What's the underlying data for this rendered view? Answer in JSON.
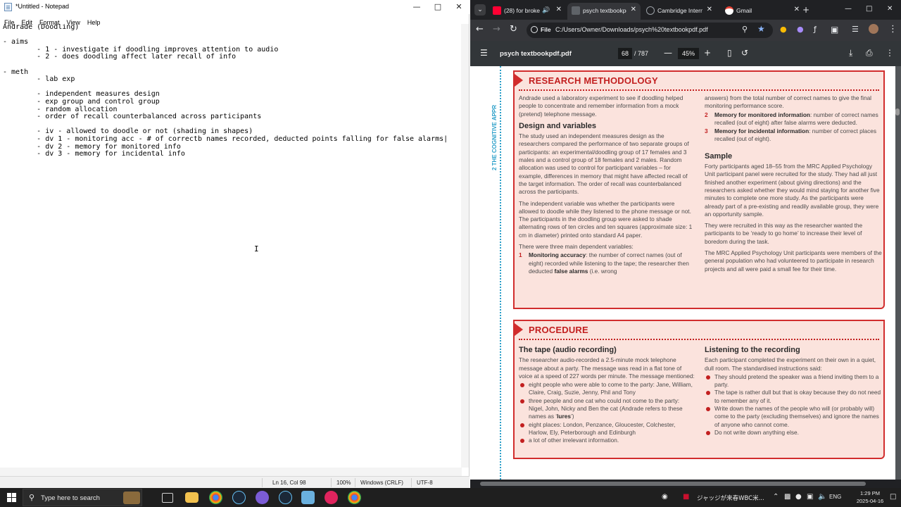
{
  "notepad": {
    "title": "*Untitled - Notepad",
    "menu": [
      "File",
      "Edit",
      "Format",
      "View",
      "Help"
    ],
    "lines": [
      "Andrade (Doodling)",
      "",
      "- aims",
      "        - 1 - investigate if doodling improves attention to audio",
      "        - 2 - does doodling affect later recall of info",
      "",
      "- meth",
      "        - lab exp",
      "",
      "        - independent measures design",
      "        - exp group and control group",
      "        - random allocation",
      "        - order of recall counterbalanced across participants",
      "",
      "        - iv - allowed to doodle or not (shading in shapes)",
      "        - dv 1 - monitoring acc - # of correctb names recorded, deducted points falling for false alarms|",
      "        - dv 2 - memory for monitored info",
      "        - dv 3 - memory for incidental info"
    ],
    "status": {
      "position": "Ln 16, Col 98",
      "zoom": "100%",
      "line_endings": "Windows (CRLF)",
      "encoding": "UTF-8"
    }
  },
  "chrome": {
    "tabs": [
      {
        "label": "(28) for broke",
        "favicon_color": "#ff0033",
        "active": false
      },
      {
        "label": "psych textbookpd",
        "favicon_color": "#5f6368",
        "active": true
      },
      {
        "label": "Cambridge Intern",
        "favicon_color": "#9aa0a6",
        "active": false
      },
      {
        "label": "Gmail",
        "favicon_color": "#ffffff",
        "active": false
      }
    ],
    "omnibox": {
      "scheme_chip": "File",
      "url": "C:/Users/Owner/Downloads/psych%20textbookpdf.pdf"
    },
    "pdf": {
      "title": "psych textbookpdf.pdf",
      "page": "68",
      "total": "/ 787",
      "zoom": "45%"
    }
  },
  "document": {
    "side_label": "2 THE COGNITIVE APPR",
    "research": {
      "heading": "RESEARCH METHODOLOGY",
      "intro": "Andrade used a laboratory experiment to see if doodling helped people to concentrate and remember information from a mock (pretend) telephone message.",
      "design_heading": "Design and variables",
      "design_p1": "The study used an independent measures design as the researchers compared the performance of two separate groups of participants: an experimental/doodling group of 17 females and 3 males and a control group of 18 females and 2 males. Random allocation was used to control for participant variables – for example, differences in memory that might have affected recall of the target information. The order of recall was counterbalanced across the participants.",
      "design_p2": "The independent variable was whether the participants were allowed to doodle while they listened to the phone message or not. The participants in the doodling group were asked to shade alternating rows of ten circles and ten squares (approximate size: 1 cm in diameter) printed onto standard A4 paper.",
      "design_p3": "There were three main dependent variables:",
      "dv1_num": "1",
      "dv1_bold": "Monitoring accuracy",
      "dv1_text": ": the number of correct names (out of eight) recorded while listening to the tape; the researcher then deducted ",
      "dv1_bold2": "false alarms",
      "dv1_text2": " (i.e. wrong",
      "dv1_cont": "answers) from the total number of correct names to give the final monitoring performance score.",
      "dv2_num": "2",
      "dv2_bold": "Memory for monitored information",
      "dv2_text": ": number of correct names recalled (out of eight) after false alarms were deducted.",
      "dv3_num": "3",
      "dv3_bold": "Memory for incidental information",
      "dv3_text": ": number of correct places recalled (out of eight).",
      "sample_heading": "Sample",
      "sample_p1": "Forty participants aged 18–55 from the MRC Applied Psychology Unit participant panel were recruited for the study. They had all just finished another experiment (about giving directions) and the researchers asked whether they would mind staying for another five minutes to complete one more study. As the participants were already part of a pre-existing and readily available group, they were an opportunity sample.",
      "sample_p2": "They were recruited in this way as the researcher wanted the participants to be ‘ready to go home’ to increase their level of boredom during the task.",
      "sample_p3": "The MRC Applied Psychology Unit participants were members of the general population who had volunteered to participate in research projects and all were paid a small fee for their time."
    },
    "procedure": {
      "heading": "PROCEDURE",
      "tape_heading": "The tape (audio recording)",
      "tape_p": "The researcher audio-recorded a 2.5-minute mock telephone message about a party. The message was read in a flat tone of voice at a speed of 227 words per minute. The message mentioned:",
      "tape_b1": "eight people who were able to come to the party: Jane, William, Claire, Craig, Suzie, Jenny, Phil and Tony",
      "tape_b2a": "three people and one cat who could not come to the party: Nigel, John, Nicky and Ben the cat (Andrade refers to these names as ‘",
      "tape_b2b": "lures",
      "tape_b2c": "’)",
      "tape_b3": "eight places: London, Penzance, Gloucester, Colchester, Harlow, Ely, Peterborough and Edinburgh",
      "tape_b4": "a lot of other irrelevant information.",
      "listen_heading": "Listening to the recording",
      "listen_p": "Each participant completed the experiment on their own in a quiet, dull room. The standardised instructions said:",
      "listen_b1": "They should pretend the speaker was a friend inviting them to a party.",
      "listen_b2": "The tape is rather dull but that is okay because they do not need to remember any of it.",
      "listen_b3": "Write down the names of the people who will (or probably will) come to the party (excluding themselves) and ignore the names of anyone who cannot come.",
      "listen_b4": "Do not write down anything else."
    }
  },
  "taskbar": {
    "search_placeholder": "Type here to search",
    "tray_news": "ジャッジが来春WBC米...",
    "language": "ENG",
    "time": "1:29 PM",
    "date": "2025-04-16"
  }
}
